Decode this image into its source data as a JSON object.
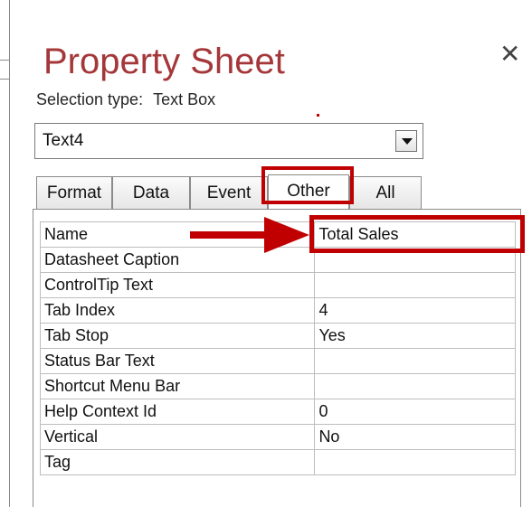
{
  "header": {
    "title": "Property Sheet",
    "selection_type_label": "Selection type:",
    "selection_type_value": "Text Box",
    "close_glyph": "✕"
  },
  "object_selector": {
    "value": "Text4"
  },
  "tabs": [
    {
      "label": "Format"
    },
    {
      "label": "Data"
    },
    {
      "label": "Event"
    },
    {
      "label": "Other",
      "active": true
    },
    {
      "label": "All"
    }
  ],
  "properties": [
    {
      "name": "Name",
      "value": "Total Sales"
    },
    {
      "name": "Datasheet Caption",
      "value": ""
    },
    {
      "name": "ControlTip Text",
      "value": ""
    },
    {
      "name": "Tab Index",
      "value": "4"
    },
    {
      "name": "Tab Stop",
      "value": "Yes"
    },
    {
      "name": "Status Bar Text",
      "value": ""
    },
    {
      "name": "Shortcut Menu Bar",
      "value": ""
    },
    {
      "name": "Help Context Id",
      "value": "0"
    },
    {
      "name": "Vertical",
      "value": "No"
    },
    {
      "name": "Tag",
      "value": ""
    }
  ],
  "colors": {
    "accent": "#a4373a",
    "annotation": "#c00000"
  }
}
